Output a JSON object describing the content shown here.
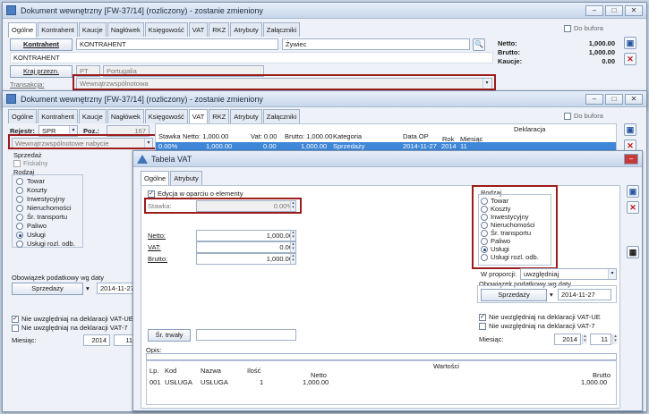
{
  "win1": {
    "title": "Dokument wewnętrzny [FW-37/14] (rozliczony) - zostanie zmieniony",
    "tabs": [
      "Ogólne",
      "Kontrahent",
      "Kaucje",
      "Nagłówek",
      "Księgowość",
      "VAT",
      "RKZ",
      "Atrybuty",
      "Załączniki"
    ],
    "do_bufora": "Do bufora",
    "kontrahent_label": "Kontrahent",
    "kontrahent_code": "KONTRAHENT",
    "kontrahent_name": "KONTRAHENT",
    "city": "Żywiec",
    "kraj_label": "Kraj przezn.",
    "kraj_code": "PT",
    "kraj_name": "Portugalia",
    "transakcja_label": "Transakcja:",
    "transakcja_value": "Wewnątrzwspólnotowa",
    "netto_label": "Netto:",
    "netto_value": "1,000.00",
    "brutto_label": "Brutto:",
    "brutto_value": "1,000.00",
    "kaucje_label": "Kaucje:",
    "kaucje_value": "0.00"
  },
  "win2": {
    "title": "Dokument wewnętrzny [FW-37/14] (rozliczony) - zostanie zmieniony",
    "tabs": [
      "Ogólne",
      "Kontrahent",
      "Kaucje",
      "Nagłówek",
      "Księgowość",
      "VAT",
      "RKZ",
      "Atrybuty",
      "Załączniki"
    ],
    "do_bufora": "Do bufora",
    "rejestr_label": "Rejestr:",
    "rejestr_value": "SPR",
    "poz_label": "Poz.:",
    "poz_value": "167",
    "type_value": "Wewnątrzwspólnotowe nabycie",
    "grid_headers": [
      "Stawka",
      "Netto: 1,000.00",
      "Vat: 0.00",
      "Brutto: 1,000.00",
      "Kategoria",
      "Data OP",
      "Rok",
      "Miesiąc"
    ],
    "grid_group_header": "Deklaracja",
    "grid_row": [
      "0.00%",
      "1,000.00",
      "0.00",
      "1,000.00",
      "Sprzedaży",
      "2014-11-27",
      "2014",
      "11"
    ],
    "sprzedaz_label": "Sprzedaż",
    "fiskalny_label": "Fiskalny",
    "rodzaj_label": "Rodzaj",
    "rodzaj_items": [
      "Towar",
      "Koszty",
      "Inwestycyjny",
      "Nieruchomości",
      "Śr. transportu",
      "Paliwo",
      "Usługi",
      "Usługi rozl. odb."
    ],
    "obowiazek_label": "Obowiązek podatkowy wg daty",
    "obowiazek_button": "Sprzedaży",
    "obowiazek_date": "2014-11-27",
    "nie_vat_ue": "Nie uwzględniaj na deklaracji VAT-UE",
    "nie_vat_7": "Nie uwzględniaj na deklaracji VAT-7",
    "miesiac_label": "Miesiąc:",
    "miesiac_year": "2014",
    "miesiac_month": "11"
  },
  "tabela": {
    "title": "Tabela VAT",
    "tabs": [
      "Ogólne",
      "Atrybuty"
    ],
    "edycja_label": "Edycja w oparciu o elementy",
    "stawka_label": "Stawka:",
    "stawka_value": "0.00%",
    "netto_label": "Netto:",
    "netto_value": "1,000.00",
    "vat_label": "VAT:",
    "vat_value": "0.00",
    "brutto_label": "Brutto:",
    "brutto_value": "1,000.00",
    "rodzaj_label": "Rodzaj",
    "rodzaj_items": [
      "Towar",
      "Koszty",
      "Inwestycyjny",
      "Nieruchomości",
      "Śr. transportu",
      "Paliwo",
      "Usługi",
      "Usługi rozl. odb."
    ],
    "rodzaj_selected": 6,
    "w_proporcji_label": "W proporcji:",
    "w_proporcji_value": "uwzględniaj",
    "obowiazek_label": "Obowiązek podatkowy wg daty",
    "obowiazek_button": "Sprzedaży",
    "obowiazek_date": "2014-11-27",
    "nie_vat_ue": "Nie uwzględniaj na deklaracji VAT-UE",
    "nie_vat_7": "Nie uwzględniaj na deklaracji VAT-7",
    "miesiac_label": "Miesiąc:",
    "miesiac_year": "2014",
    "miesiac_month": "11",
    "sr_trwaly_button": "Śr. trwały",
    "opis_label": "Opis:",
    "grid_headers": [
      "Lp.",
      "Kod",
      "Nazwa",
      "Ilość",
      "Netto",
      "Brutto"
    ],
    "grid_group_header": "Wartości",
    "grid_row": [
      "001",
      "USŁUGA",
      "USŁUGA",
      "1",
      "1,000.00",
      "1,000.00"
    ]
  },
  "colors": {
    "selection": "#3d86d8",
    "highlight_border": "#9c1c1c"
  }
}
